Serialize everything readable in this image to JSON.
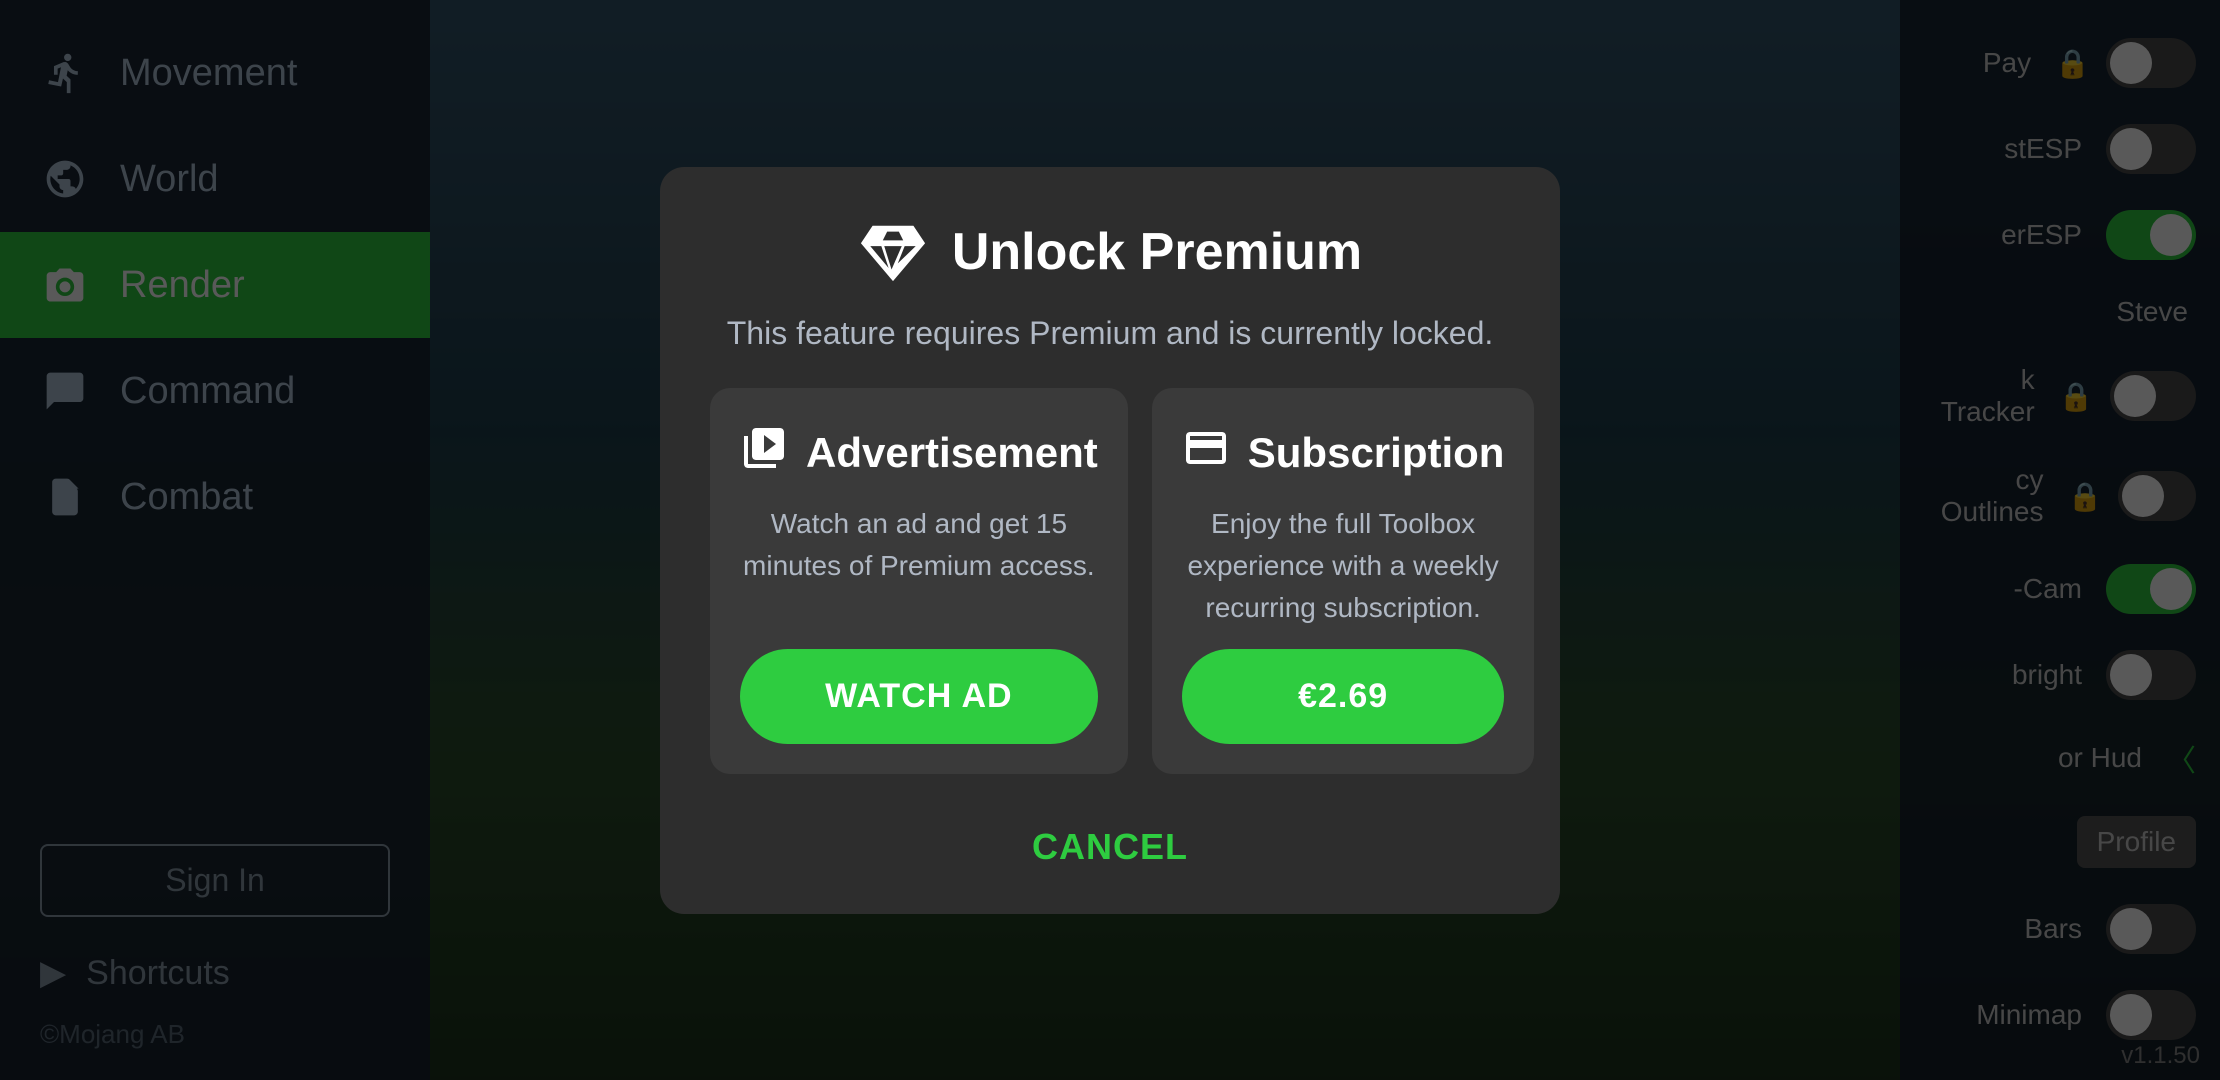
{
  "background": {
    "color_top": "#5a8aab",
    "color_bottom": "#2a4a2a"
  },
  "sidebar": {
    "items": [
      {
        "id": "movement",
        "label": "Movement",
        "icon": "🏃",
        "active": false
      },
      {
        "id": "world",
        "label": "World",
        "icon": "⬜",
        "active": false
      },
      {
        "id": "render",
        "label": "Render",
        "icon": "📷",
        "active": true
      },
      {
        "id": "command",
        "label": "Command",
        "icon": "💬",
        "active": false
      },
      {
        "id": "combat",
        "label": "Combat",
        "icon": "✖",
        "active": false
      }
    ],
    "sign_in_label": "Sign In",
    "shortcuts_label": "Shortcuts",
    "shortcuts_icon": "▶",
    "mojang_label": "©Mojang AB"
  },
  "right_panel": {
    "items": [
      {
        "label": "Pay",
        "locked": false,
        "toggle": false,
        "toggle_on": false
      },
      {
        "label": "stESP",
        "locked": false,
        "toggle": true,
        "toggle_on": false
      },
      {
        "label": "erESP",
        "locked": false,
        "toggle": true,
        "toggle_on": true
      },
      {
        "label": "Steve",
        "locked": false,
        "toggle": false,
        "toggle_on": false
      },
      {
        "label": "k Tracker",
        "locked": true,
        "toggle": true,
        "toggle_on": false
      },
      {
        "label": "cy Outlines",
        "locked": true,
        "toggle": true,
        "toggle_on": false
      },
      {
        "label": "-Cam",
        "locked": false,
        "toggle": true,
        "toggle_on": true
      },
      {
        "label": "bright",
        "locked": false,
        "toggle": true,
        "toggle_on": false
      },
      {
        "label": "or Hud",
        "locked": false,
        "toggle": true,
        "toggle_on": false
      },
      {
        "label": "Bars",
        "locked": false,
        "toggle": true,
        "toggle_on": false
      },
      {
        "label": "Minimap",
        "locked": false,
        "toggle": true,
        "toggle_on": false
      }
    ],
    "version": "v1.1.50",
    "profile_label": "Profile"
  },
  "modal": {
    "title": "Unlock Premium",
    "subtitle": "This feature requires Premium and is currently locked.",
    "diamond_icon_label": "diamond-icon",
    "ad_card": {
      "title": "Advertisement",
      "icon": "🎬",
      "description": "Watch an ad and get 15 minutes of Premium access.",
      "button_label": "WATCH AD"
    },
    "subscription_card": {
      "title": "Subscription",
      "icon": "💳",
      "description": "Enjoy the full Toolbox experience with a weekly recurring subscription.",
      "button_label": "€2.69"
    },
    "cancel_label": "CANCEL"
  }
}
